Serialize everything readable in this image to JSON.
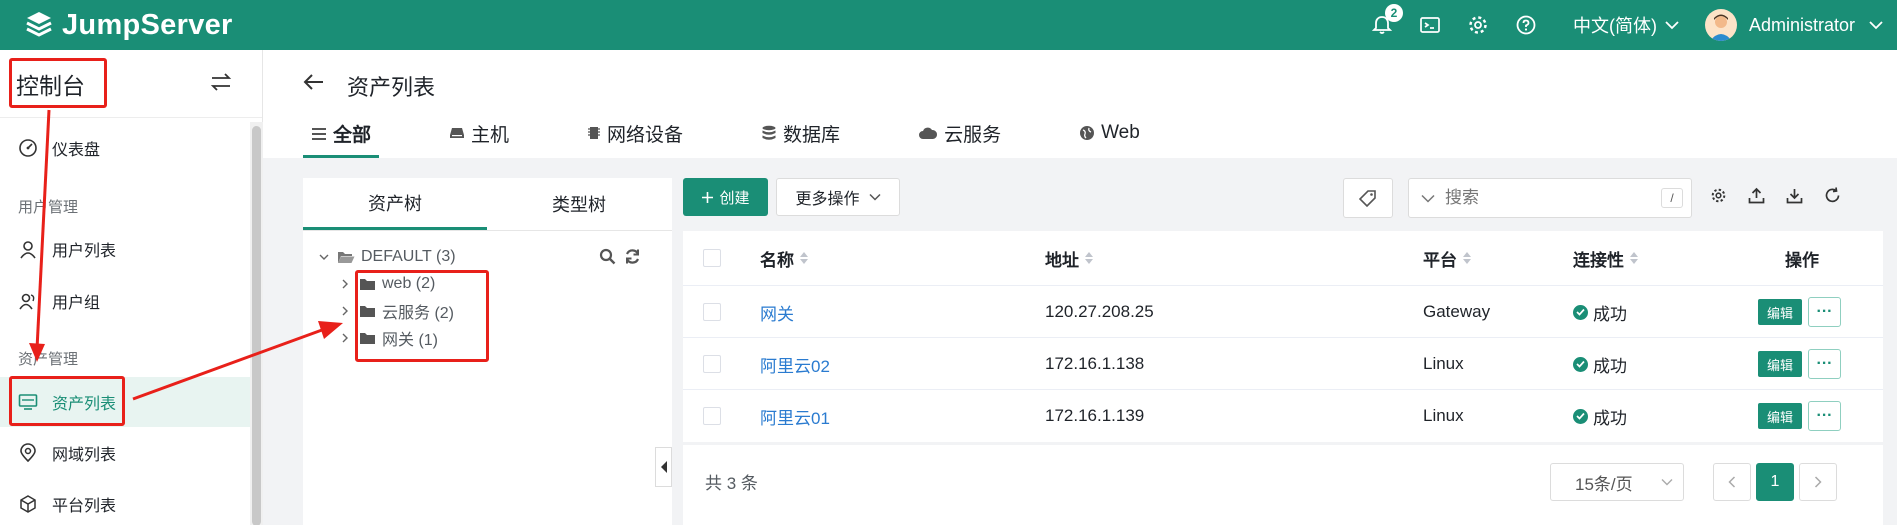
{
  "app": {
    "name": "JumpServer"
  },
  "topbar": {
    "notification_count": "2",
    "language": "中文(简体)",
    "user_name": "Administrator"
  },
  "sidebar": {
    "title": "控制台",
    "items": [
      {
        "label": "仪表盘",
        "icon": "dashboard-icon"
      },
      {
        "group": "用户管理"
      },
      {
        "label": "用户列表",
        "icon": "user-icon"
      },
      {
        "label": "用户组",
        "icon": "user-group-icon"
      },
      {
        "group": "资产管理"
      },
      {
        "label": "资产列表",
        "icon": "monitor-icon",
        "active": true
      },
      {
        "label": "网域列表",
        "icon": "location-icon"
      },
      {
        "label": "平台列表",
        "icon": "cube-icon"
      }
    ]
  },
  "page": {
    "title": "资产列表",
    "tabs": [
      {
        "label": "全部",
        "icon": "list-icon",
        "active": true
      },
      {
        "label": "主机",
        "icon": "host-icon"
      },
      {
        "label": "网络设备",
        "icon": "network-device-icon"
      },
      {
        "label": "数据库",
        "icon": "database-icon"
      },
      {
        "label": "云服务",
        "icon": "cloud-icon"
      },
      {
        "label": "Web",
        "icon": "globe-icon"
      }
    ]
  },
  "tree": {
    "tabs": [
      "资产树",
      "类型树"
    ],
    "root": "DEFAULT (3)",
    "nodes": [
      "web (2)",
      "云服务 (2)",
      "网关 (1)"
    ]
  },
  "toolbar": {
    "create_label": "创建",
    "more_label": "更多操作",
    "search_placeholder": "搜索",
    "search_shortcut": "/"
  },
  "table": {
    "headers": {
      "name": "名称",
      "address": "地址",
      "platform": "平台",
      "connectivity": "连接性",
      "actions": "操作"
    },
    "rows": [
      {
        "name": "网关",
        "address": "120.27.208.25",
        "platform": "Gateway",
        "connectivity": "成功"
      },
      {
        "name": "阿里云02",
        "address": "172.16.1.138",
        "platform": "Linux",
        "connectivity": "成功"
      },
      {
        "name": "阿里云01",
        "address": "172.16.1.139",
        "platform": "Linux",
        "connectivity": "成功"
      }
    ],
    "edit_label": "编辑",
    "more_label": "···"
  },
  "pagination": {
    "total": "共 3 条",
    "page_size": "15条/页",
    "current_page": "1"
  },
  "colors": {
    "brand": "#1a8e76",
    "annotation": "#e8201a",
    "link": "#2a7bd0"
  }
}
